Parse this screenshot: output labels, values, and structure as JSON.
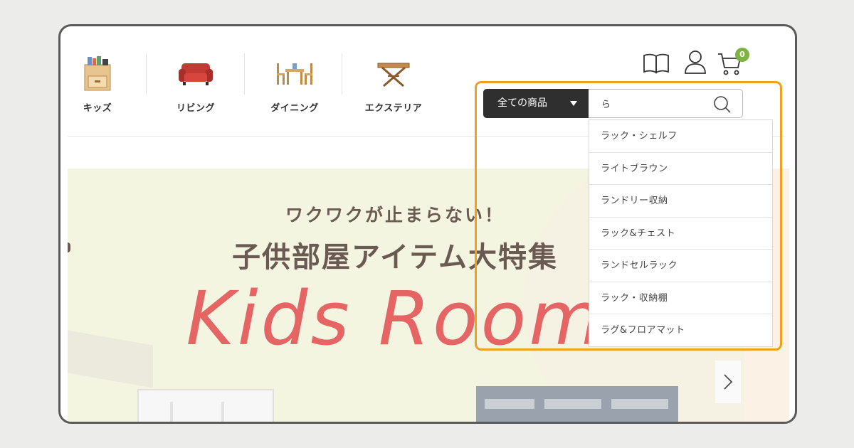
{
  "nav": {
    "categories": [
      {
        "label": "キッズ",
        "icon": "kids-shelf-icon"
      },
      {
        "label": "リビング",
        "icon": "red-sofa-icon"
      },
      {
        "label": "ダイニング",
        "icon": "dining-set-icon"
      },
      {
        "label": "エクステリア",
        "icon": "outdoor-table-icon"
      }
    ]
  },
  "header": {
    "cart_count": "0",
    "icons": [
      "catalog-book-icon",
      "account-icon",
      "cart-icon"
    ]
  },
  "search": {
    "scope_label": "全ての商品",
    "query": "ら",
    "suggestions": [
      "ラック・シェルフ",
      "ライトブラウン",
      "ランドリー収納",
      "ラック&チェスト",
      "ランドセルラック",
      "ラック・収納棚",
      "ラグ&フロアマット"
    ]
  },
  "banner": {
    "subtitle": "ワクワクが止まらない！",
    "title": "子供部屋アイテム大特集",
    "headline": "Kids Room"
  },
  "colors": {
    "accent_highlight": "#f0a020",
    "badge": "#7cb342",
    "headline": "#e56464",
    "banner_bg": "#f4f5e1",
    "scope_bg": "#2f2f2f"
  }
}
